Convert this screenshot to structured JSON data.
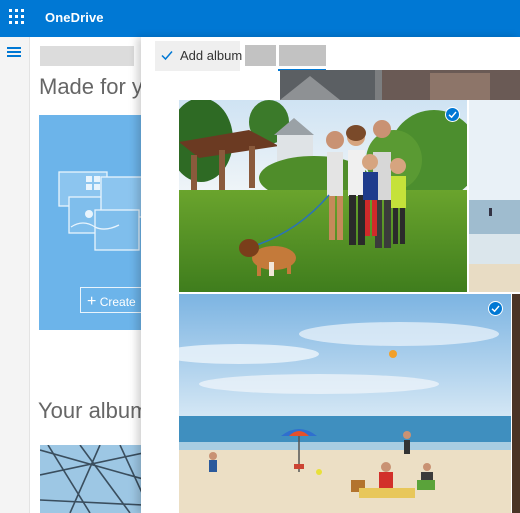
{
  "app": {
    "brand": "OneDrive"
  },
  "toolbar": {
    "add_album_label": "Add album"
  },
  "sections": {
    "made_for_you_title": "Made for y",
    "create_button_label": "Create",
    "your_albums_title": "Your album"
  },
  "colors": {
    "accent": "#0078d4",
    "card": "#6cb4ea",
    "selected_badge": "#0078d4"
  },
  "photos": [
    {
      "name": "family-photo",
      "selected": true
    },
    {
      "name": "beach-photo",
      "selected": true
    }
  ]
}
